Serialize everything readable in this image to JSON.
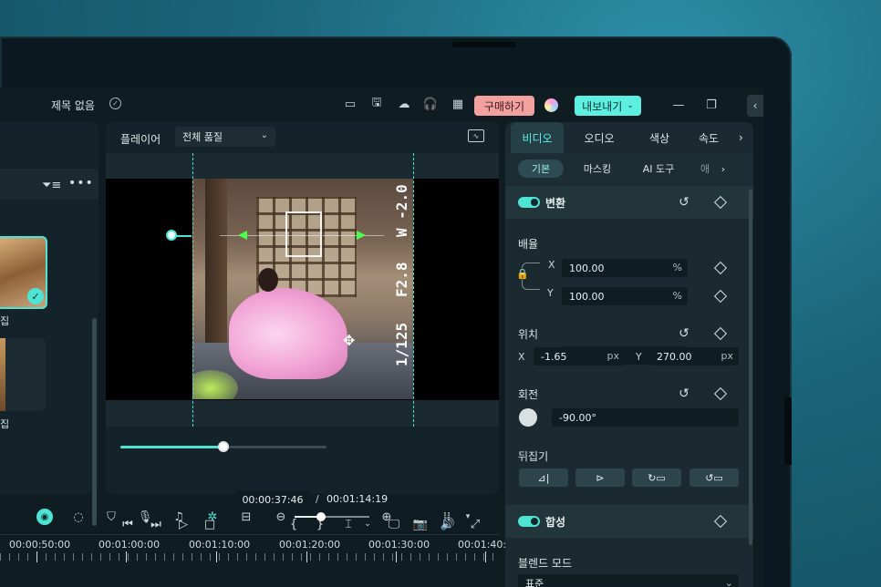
{
  "titlebar": {
    "title": "제목 없음",
    "buy_label": "구매하기",
    "export_label": "내보내기",
    "icons": [
      "layout-icon",
      "save-icon",
      "cloud-icon",
      "support-icon",
      "grid-icon"
    ]
  },
  "media": {
    "items": [
      {
        "label": "집",
        "selected": true
      },
      {
        "label": "집",
        "selected": false
      }
    ]
  },
  "player": {
    "title": "플레이어",
    "quality": "전체 품질",
    "current_time": "00:00:37:46",
    "separator": "/",
    "total_time": "00:01:14:19",
    "progress": 0.5,
    "photo_overlay": [
      "1/125",
      "F2.8",
      "W -2.0"
    ]
  },
  "props": {
    "tabs": [
      "비디오",
      "오디오",
      "색상",
      "속도"
    ],
    "subtabs": [
      "기본",
      "마스킹",
      "AI 도구",
      "애"
    ],
    "transform": {
      "title": "변환",
      "scale_label": "배율",
      "scale_x": "100.00",
      "scale_y": "100.00",
      "scale_unit": "%",
      "position_label": "위치",
      "pos_x": "-1.65",
      "pos_y": "270.00",
      "pos_unit": "px",
      "rotation_label": "회전",
      "rotation": "-90.00°",
      "flip_label": "뒤집기",
      "axis_x": "X",
      "axis_y": "Y"
    },
    "compositing": {
      "title": "합성",
      "blend_label": "블렌드 모드",
      "blend_value": "표준"
    }
  },
  "timeline": {
    "zoom_level": 0.35,
    "ruler": [
      "00:00:50:00",
      "00:01:00:00",
      "00:01:10:00",
      "00:01:20:00",
      "00:01:30:00",
      "00:01:40:"
    ]
  },
  "colors": {
    "accent": "#5df0e2",
    "buy_bg": "#f2a0a0"
  }
}
